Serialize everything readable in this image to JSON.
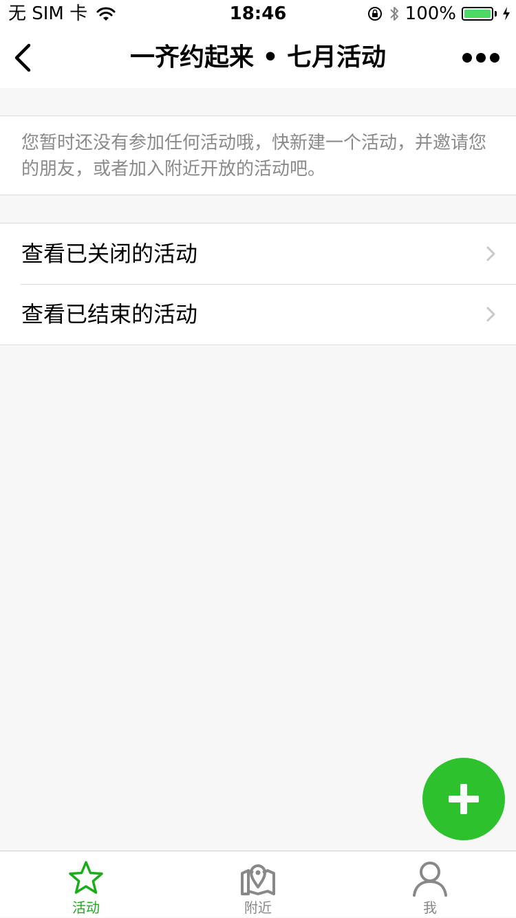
{
  "status_bar": {
    "carrier": "无 SIM 卡",
    "time": "18:46",
    "battery": "100%",
    "battery_color": "#4cd964"
  },
  "nav": {
    "title": "一齐约起来 • 七月活动",
    "back_icon": "chevron-left-icon",
    "more_icon": "more-dots-icon"
  },
  "notice": {
    "text": "您暂时还没有参加任何活动哦，快新建一个活动，并邀请您的朋友，或者加入附近开放的活动吧。"
  },
  "list": {
    "items": [
      {
        "label": "查看已关闭的活动"
      },
      {
        "label": "查看已结束的活动"
      }
    ]
  },
  "fab": {
    "icon": "plus-icon",
    "color": "#2dc22d"
  },
  "tabs": [
    {
      "label": "活动",
      "icon": "star-icon",
      "active": true
    },
    {
      "label": "附近",
      "icon": "map-pin-icon",
      "active": false
    },
    {
      "label": "我",
      "icon": "user-icon",
      "active": false
    }
  ],
  "colors": {
    "accent": "#1aad19",
    "inactive": "#888888"
  }
}
